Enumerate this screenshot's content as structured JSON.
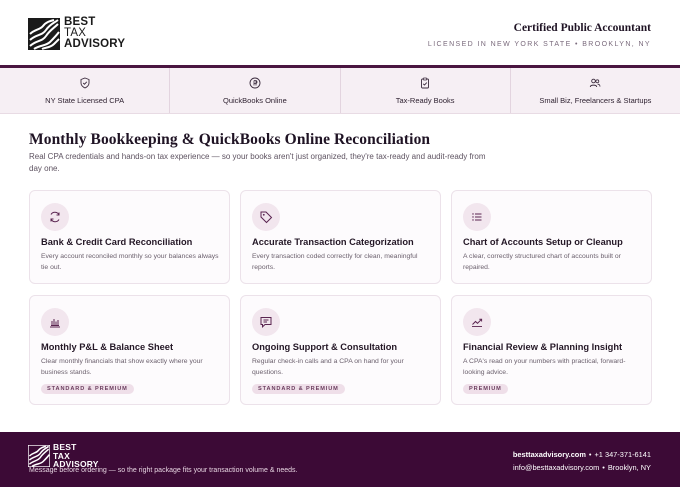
{
  "brand": {
    "logo_line1": "BEST",
    "logo_line1b": "TAX",
    "logo_line2": "ADVISORY",
    "title": "Certified Public Accountant",
    "subtitle": "LICENSED IN NEW YORK STATE • BROOKLYN, NY"
  },
  "strip": [
    {
      "label": "NY State Licensed CPA",
      "icon": "shield-check-icon"
    },
    {
      "label": "QuickBooks Online",
      "icon": "quickbooks-icon"
    },
    {
      "label": "Tax-Ready Books",
      "icon": "clipboard-check-icon"
    },
    {
      "label": "Small Biz, Freelancers & Startups",
      "icon": "users-icon"
    }
  ],
  "main": {
    "title": "Monthly Bookkeeping & QuickBooks Online Reconciliation",
    "subtitle": "Real CPA credentials and hands-on tax experience — so your books aren't just organized, they're tax-ready and audit-ready from day one."
  },
  "cards": [
    {
      "title": "Bank & Credit Card Reconciliation",
      "desc": "Every account reconciled monthly so your balances always tie out.",
      "badge": "",
      "icon": "refresh-icon"
    },
    {
      "title": "Accurate Transaction Categorization",
      "desc": "Every transaction coded correctly for clean, meaningful reports.",
      "badge": "",
      "icon": "tag-icon"
    },
    {
      "title": "Chart of Accounts Setup or Cleanup",
      "desc": "A clear, correctly structured chart of accounts built or repaired.",
      "badge": "",
      "icon": "list-icon"
    },
    {
      "title": "Monthly P&L & Balance Sheet",
      "desc": "Clear monthly financials that show exactly where your business stands.",
      "badge": "STANDARD & PREMIUM",
      "icon": "bank-icon"
    },
    {
      "title": "Ongoing Support & Consultation",
      "desc": "Regular check-in calls and a CPA on hand for your questions.",
      "badge": "STANDARD & PREMIUM",
      "icon": "chat-icon"
    },
    {
      "title": "Financial Review & Planning Insight",
      "desc": "A CPA's read on your numbers with practical, forward-looking advice.",
      "badge": "PREMIUM",
      "icon": "trend-up-icon"
    }
  ],
  "footer": {
    "message": "Message before ordering — so the right package fits your transaction volume & needs.",
    "website": "besttaxadvisory.com",
    "phone": "+1 347-371-6141",
    "email": "info@besttaxadvisory.com",
    "location": "Brooklyn, NY",
    "bullet": "•"
  },
  "colors": {
    "accent": "#4a1540",
    "footer_bg": "#3c0a36",
    "strip_bg": "#f6eff4",
    "icon_bg": "#f2e6ee",
    "icon_stroke": "#5a2450"
  }
}
